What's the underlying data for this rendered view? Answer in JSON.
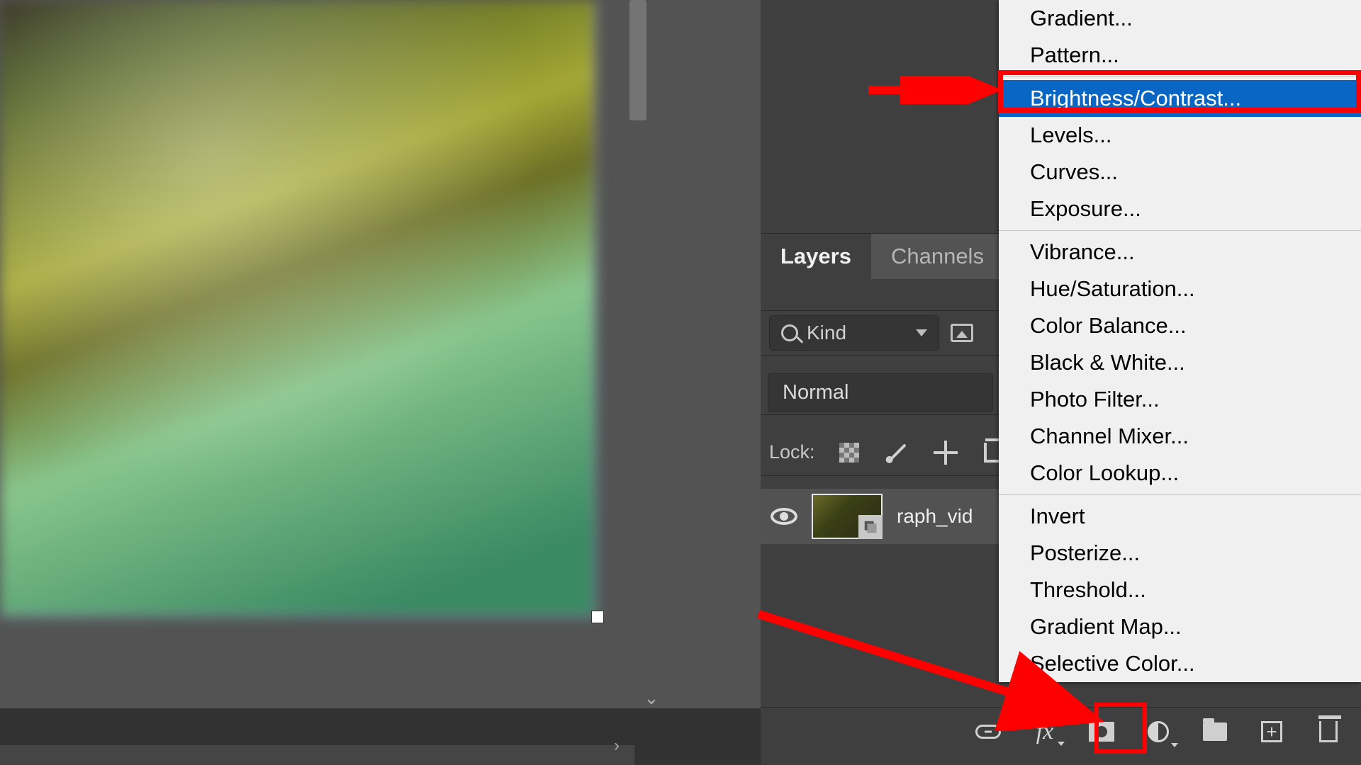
{
  "canvas": {
    "handle_label": "transform-handle"
  },
  "panel": {
    "tabs": {
      "layers": "Layers",
      "channels": "Channels"
    },
    "kind_label": "Kind",
    "blend_mode": "Normal",
    "lock_label": "Lock:",
    "layer_name": "raph_vid"
  },
  "menu": {
    "items_group1": [
      "Gradient...",
      "Pattern..."
    ],
    "items_group2": [
      "Brightness/Contrast...",
      "Levels...",
      "Curves...",
      "Exposure..."
    ],
    "items_group3": [
      "Vibrance...",
      "Hue/Saturation...",
      "Color Balance...",
      "Black & White...",
      "Photo Filter...",
      "Channel Mixer...",
      "Color Lookup..."
    ],
    "items_group4": [
      "Invert",
      "Posterize...",
      "Threshold...",
      "Gradient Map...",
      "Selective Color..."
    ],
    "selected": "Brightness/Contrast..."
  },
  "bottom_icons": {
    "link": "link-layers-icon",
    "fx": "fx",
    "mask": "add-mask-icon",
    "adj": "new-adjustment-layer-icon",
    "group": "new-group-icon",
    "new": "new-layer-icon",
    "trash": "delete-layer-icon"
  }
}
